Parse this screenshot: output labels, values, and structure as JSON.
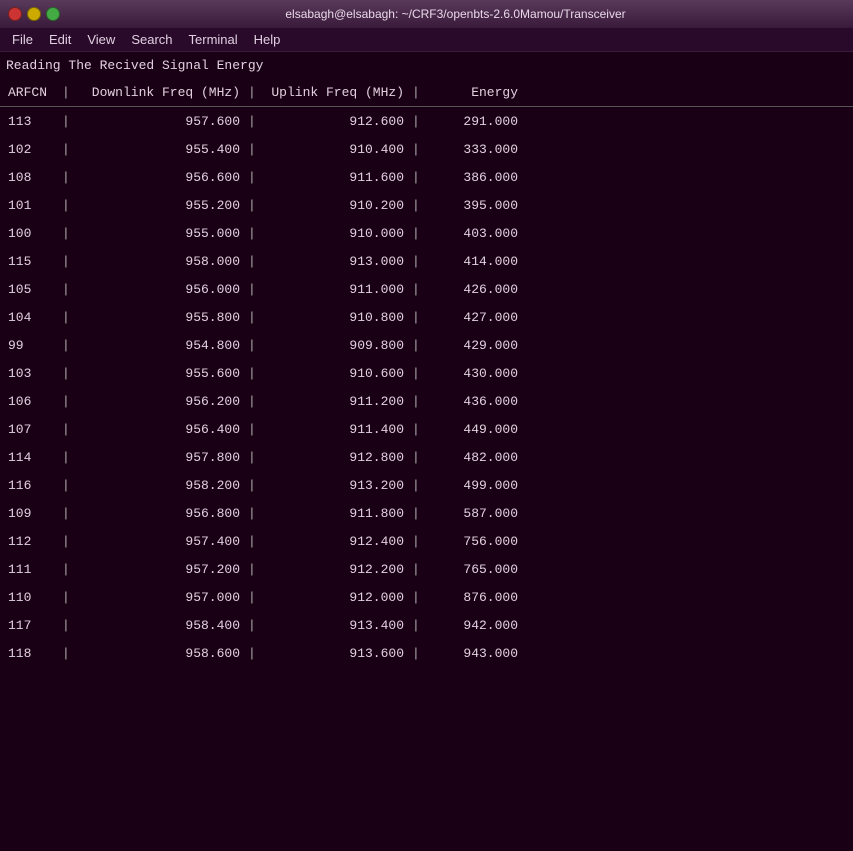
{
  "titlebar": {
    "title": "elsabagh@elsabagh: ~/CRF3/openbts-2.6.0Mamou/Transceiver",
    "buttons": {
      "close": "close",
      "minimize": "minimize",
      "maximize": "maximize"
    }
  },
  "menubar": {
    "items": [
      "File",
      "Edit",
      "View",
      "Search",
      "Terminal",
      "Help"
    ]
  },
  "terminal": {
    "reading_line": "Reading The Recived Signal Energy",
    "headers": {
      "arfcn": "ARFCN",
      "downlink": "Downlink Freq (MHz)",
      "uplink": "Uplink Freq (MHz)",
      "energy": "Energy"
    },
    "rows": [
      {
        "arfcn": "113",
        "downlink": "957.600",
        "uplink": "912.600",
        "energy": "291.000"
      },
      {
        "arfcn": "102",
        "downlink": "955.400",
        "uplink": "910.400",
        "energy": "333.000"
      },
      {
        "arfcn": "108",
        "downlink": "956.600",
        "uplink": "911.600",
        "energy": "386.000"
      },
      {
        "arfcn": "101",
        "downlink": "955.200",
        "uplink": "910.200",
        "energy": "395.000"
      },
      {
        "arfcn": "100",
        "downlink": "955.000",
        "uplink": "910.000",
        "energy": "403.000"
      },
      {
        "arfcn": "115",
        "downlink": "958.000",
        "uplink": "913.000",
        "energy": "414.000"
      },
      {
        "arfcn": "105",
        "downlink": "956.000",
        "uplink": "911.000",
        "energy": "426.000"
      },
      {
        "arfcn": "104",
        "downlink": "955.800",
        "uplink": "910.800",
        "energy": "427.000"
      },
      {
        "arfcn": "99",
        "downlink": "954.800",
        "uplink": "909.800",
        "energy": "429.000"
      },
      {
        "arfcn": "103",
        "downlink": "955.600",
        "uplink": "910.600",
        "energy": "430.000"
      },
      {
        "arfcn": "106",
        "downlink": "956.200",
        "uplink": "911.200",
        "energy": "436.000"
      },
      {
        "arfcn": "107",
        "downlink": "956.400",
        "uplink": "911.400",
        "energy": "449.000"
      },
      {
        "arfcn": "114",
        "downlink": "957.800",
        "uplink": "912.800",
        "energy": "482.000"
      },
      {
        "arfcn": "116",
        "downlink": "958.200",
        "uplink": "913.200",
        "energy": "499.000"
      },
      {
        "arfcn": "109",
        "downlink": "956.800",
        "uplink": "911.800",
        "energy": "587.000"
      },
      {
        "arfcn": "112",
        "downlink": "957.400",
        "uplink": "912.400",
        "energy": "756.000"
      },
      {
        "arfcn": "111",
        "downlink": "957.200",
        "uplink": "912.200",
        "energy": "765.000"
      },
      {
        "arfcn": "110",
        "downlink": "957.000",
        "uplink": "912.000",
        "energy": "876.000"
      },
      {
        "arfcn": "117",
        "downlink": "958.400",
        "uplink": "913.400",
        "energy": "942.000"
      },
      {
        "arfcn": "118",
        "downlink": "958.600",
        "uplink": "913.600",
        "energy": "943.000"
      }
    ]
  }
}
